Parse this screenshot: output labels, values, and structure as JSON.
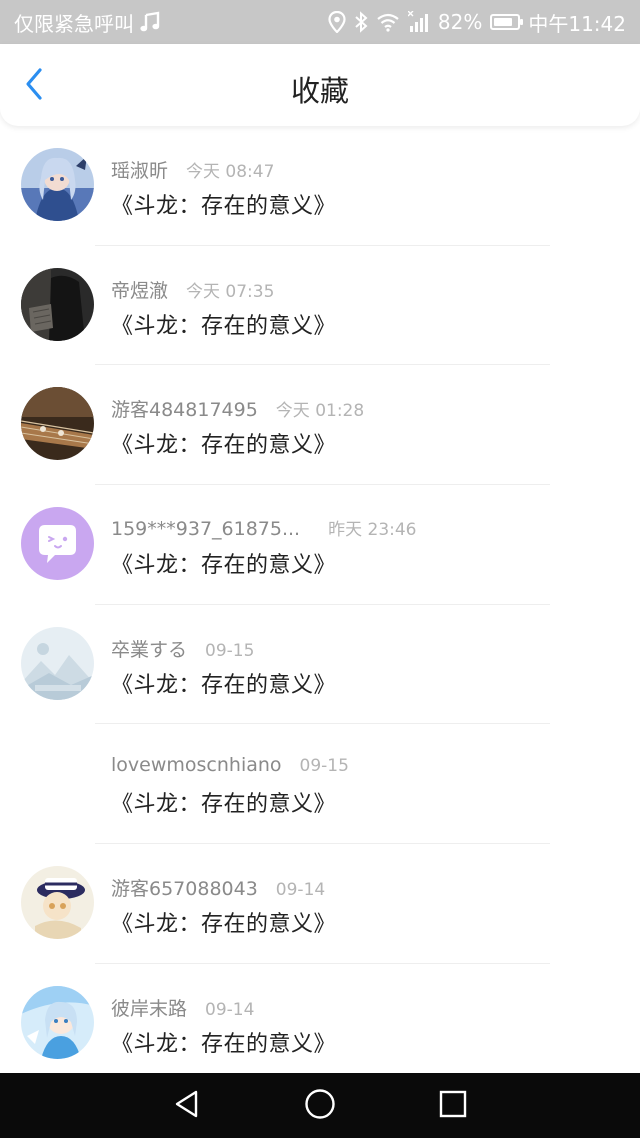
{
  "status_bar": {
    "carrier": "仅限紧急呼叫",
    "battery_percent": "82%",
    "time": "中午11:42",
    "battery_level": 0.82,
    "icons": [
      "music-note-icon",
      "location-icon",
      "bluetooth-icon",
      "wifi-icon",
      "signal-icon",
      "battery-icon"
    ]
  },
  "header": {
    "title": "收藏",
    "back_icon": "chevron-left-icon",
    "accent_color": "#2b8ef0"
  },
  "favorites": [
    {
      "username": "瑶淑昕",
      "time": "今天 08:47",
      "content": "《斗龙：存在的意义》",
      "avatar": "anime-girl-blue"
    },
    {
      "username": "帝煜澈",
      "time": "今天 07:35",
      "content": "《斗龙：存在的意义》",
      "avatar": "dark-figure"
    },
    {
      "username": "游客484817495",
      "time": "今天 01:28",
      "content": "《斗龙：存在的意义》",
      "avatar": "guzheng-instrument"
    },
    {
      "username": "159***937_61875...",
      "time": "昨天 23:46",
      "content": "《斗龙：存在的意义》",
      "avatar": "purple-chat-bubble"
    },
    {
      "username": "卒業する",
      "time": "09-15",
      "content": "《斗龙：存在的意义》",
      "avatar": "placeholder-mountains"
    },
    {
      "username": "lovewmoscnhiano",
      "time": "09-15",
      "content": "《斗龙：存在的意义》",
      "avatar": "none"
    },
    {
      "username": "游客657088043",
      "time": "09-14",
      "content": "《斗龙：存在的意义》",
      "avatar": "chibi-character-hat"
    },
    {
      "username": "彼岸末路",
      "time": "09-14",
      "content": "《斗龙：存在的意义》",
      "avatar": "anime-girl-light-blue"
    }
  ],
  "nav_bar": {
    "buttons": [
      "back-triangle-icon",
      "home-circle-icon",
      "recents-square-icon"
    ]
  }
}
